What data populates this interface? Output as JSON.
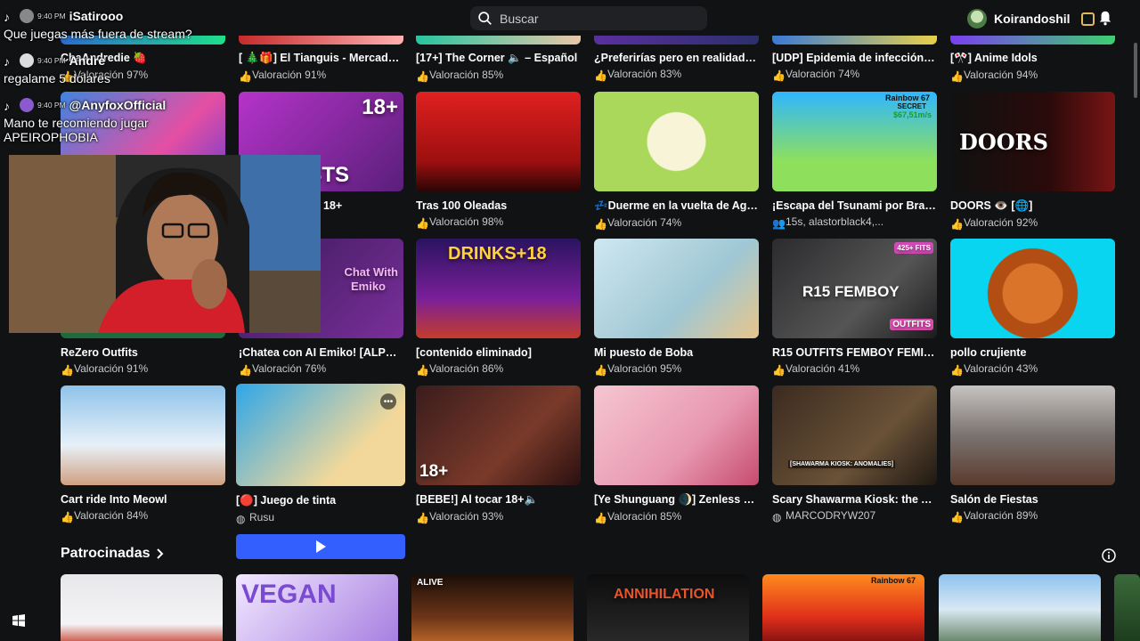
{
  "search": {
    "placeholder": "Buscar"
  },
  "user": {
    "name": "Koirandoshil"
  },
  "chat": [
    {
      "user": "iSatirooo",
      "time": "9:40 PM",
      "text": "Que juegas más fuera de stream?"
    },
    {
      "user": "Andre",
      "time": "9:40 PM",
      "text": "regalame 5 dolares"
    },
    {
      "user": "@AnyfoxOfficial",
      "time": "9:40 PM",
      "text": "Mano te recomiendo jugar",
      "text2": "APEIROPHOBIA"
    }
  ],
  "top_row": [
    {
      "title": "ChaAndredie 🍓",
      "rating": "Valoración 97%"
    },
    {
      "title": "[ 🎄🎁] El Tianguis - Mercado de",
      "rating": "Valoración 91%"
    },
    {
      "title": "[17+] The Corner 🔈 – Español",
      "rating": "Valoración 85%"
    },
    {
      "title": "¿Preferirías pero en realidad su...",
      "rating": "Valoración 83%"
    },
    {
      "title": "[UDP] Epidemia de infección de",
      "rating": "Valoración 74%"
    },
    {
      "title": "[🎌] Anime Idols",
      "rating": "Valoración 94%"
    }
  ],
  "row1": [
    {
      "title": "18+",
      "rating": ""
    },
    {
      "title": "Tras 100 Oleadas",
      "rating": "Valoración 98%"
    },
    {
      "title": "💤Duerme en la vuelta de Agne...",
      "rating": "Valoración 74%"
    },
    {
      "title": "¡Escapa del Tsunami por Brainro...",
      "rating": "15s, alastorblack4,..."
    },
    {
      "title": "DOORS 👁️ [🌐]",
      "rating": "Valoración 92%"
    }
  ],
  "row1_thumbs": {
    "asts": "ASTS",
    "eighteen": "18+",
    "doors": "DOORS",
    "rainbow": "Rainbow 67",
    "secret": "SECRET",
    "price": "$67,51m/s"
  },
  "row2": [
    {
      "title": "ReZero Outfits",
      "rating": "Valoración 91%"
    },
    {
      "title": "¡Chatea con AI Emiko! [ALPHA]",
      "rating": "Valoración 76%"
    },
    {
      "title": "[contenido eliminado]",
      "rating": "Valoración 86%"
    },
    {
      "title": "Mi puesto de Boba",
      "rating": "Valoración 95%"
    },
    {
      "title": "R15 OUTFITS FEMBOY FEMIN...",
      "rating": "Valoración 41%"
    },
    {
      "title": "pollo crujiente",
      "rating": "Valoración 43%"
    }
  ],
  "row2_thumbs": {
    "chat_with": "Chat With",
    "emiko": "Emiko",
    "drinks": "DRINKS+18",
    "fits": "425+ FITS",
    "femboy": "R15 FEMBOY",
    "outfits": "OUTFITS"
  },
  "row3": [
    {
      "title": "Cart ride Into Meowl",
      "rating": "Valoración 84%"
    },
    {
      "title": "[🔴] Juego de tinta",
      "rating": "Rusu"
    },
    {
      "title": "[BEBE!] Al tocar 18+🔈",
      "rating": "Valoración 93%"
    },
    {
      "title": "[Ye Shunguang 🌒] Zenless Zon...",
      "rating": "Valoración 85%"
    },
    {
      "title": "Scary Shawarma Kiosk: the AN...",
      "rating": "MARCODRYW207"
    },
    {
      "title": "Salón de Fiestas",
      "rating": "Valoración 89%"
    }
  ],
  "row3_thumbs": {
    "eighteen": "18+",
    "kiosk": "[SHAWARMA KIOSK: ANOMALIES]"
  },
  "sponsored": {
    "label": "Patrocinadas"
  },
  "sponsored_thumbs": {
    "vegan": "VEGAN",
    "alive": "ALIVE",
    "annihilation": "ANNIHILATION",
    "rainbow": "Rainbow 67"
  }
}
